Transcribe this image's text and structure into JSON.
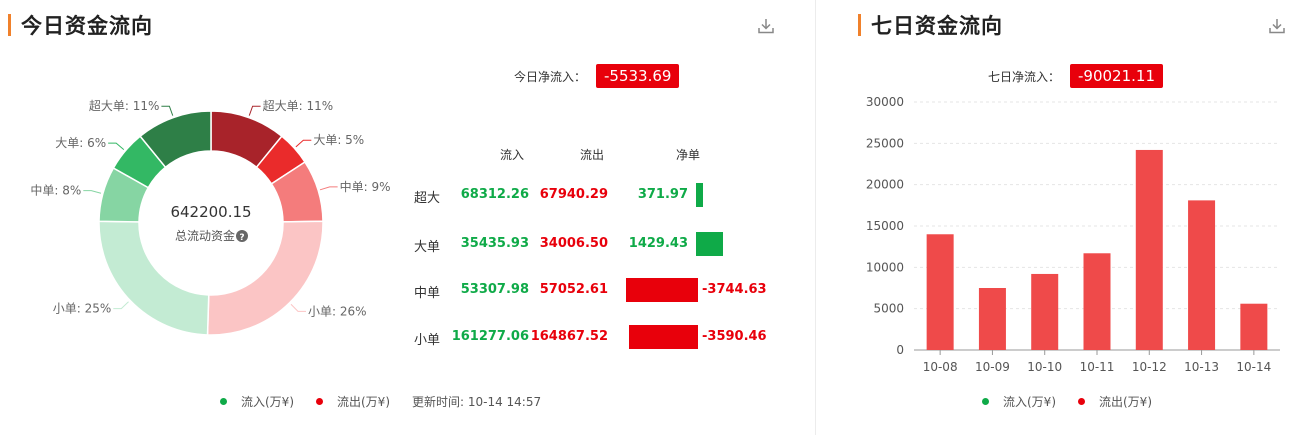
{
  "today": {
    "title": "今日资金流向",
    "net_label": "今日净流入：",
    "net_value": "-5533.69",
    "total_value": "642200.15",
    "total_label": "总流动资金",
    "headers": {
      "in": "流入",
      "out": "流出",
      "net": "净单"
    },
    "rows": [
      {
        "name": "超大",
        "in": "68312.26",
        "out": "67940.29",
        "net": "371.97",
        "net_num": 371.97
      },
      {
        "name": "大单",
        "in": "35435.93",
        "out": "34006.50",
        "net": "1429.43",
        "net_num": 1429.43
      },
      {
        "name": "中单",
        "in": "53307.98",
        "out": "57052.61",
        "net": "-3744.63",
        "net_num": -3744.63
      },
      {
        "name": "小单",
        "in": "161277.06",
        "out": "164867.52",
        "net": "-3590.46",
        "net_num": -3590.46
      }
    ],
    "legend_in": "流入(万¥)",
    "legend_out": "流出(万¥)",
    "update_time": "更新时间: 10-14 14:57",
    "colors": {
      "in": "#0faa48",
      "out": "#e8000b"
    }
  },
  "seven_day": {
    "title": "七日资金流向",
    "net_label": "七日净流入：",
    "net_value": "-90021.11",
    "legend_in": "流入(万¥)",
    "legend_out": "流出(万¥)"
  },
  "chart_data": [
    {
      "type": "pie",
      "variant": "donut",
      "slices": [
        {
          "label": "超大单: 11%",
          "percent": 11,
          "color": "#a8232a",
          "side": "right"
        },
        {
          "label": "大单: 5%",
          "percent": 5,
          "color": "#ea2b2b",
          "side": "right"
        },
        {
          "label": "中单: 9%",
          "percent": 9,
          "color": "#f47c7c",
          "side": "right"
        },
        {
          "label": "小单: 26%",
          "percent": 26,
          "color": "#fbc5c5",
          "side": "right"
        },
        {
          "label": "小单: 25%",
          "percent": 25,
          "color": "#c3ebd3",
          "side": "left"
        },
        {
          "label": "中单: 8%",
          "percent": 8,
          "color": "#86d5a3",
          "side": "left"
        },
        {
          "label": "大单: 6%",
          "percent": 6,
          "color": "#33b864",
          "side": "left"
        },
        {
          "label": "超大单: 11%",
          "percent": 11,
          "color": "#2e7f47",
          "side": "left"
        }
      ]
    },
    {
      "type": "bar",
      "categories": [
        "10-08",
        "10-09",
        "10-10",
        "10-11",
        "10-12",
        "10-13",
        "10-14"
      ],
      "values": [
        14000,
        7500,
        9200,
        11700,
        24200,
        18100,
        5600
      ],
      "ylim": [
        0,
        30000
      ],
      "yticks": [
        0,
        5000,
        10000,
        15000,
        20000,
        25000,
        30000
      ],
      "bar_color": "#ef4a4a",
      "grid": true
    }
  ]
}
